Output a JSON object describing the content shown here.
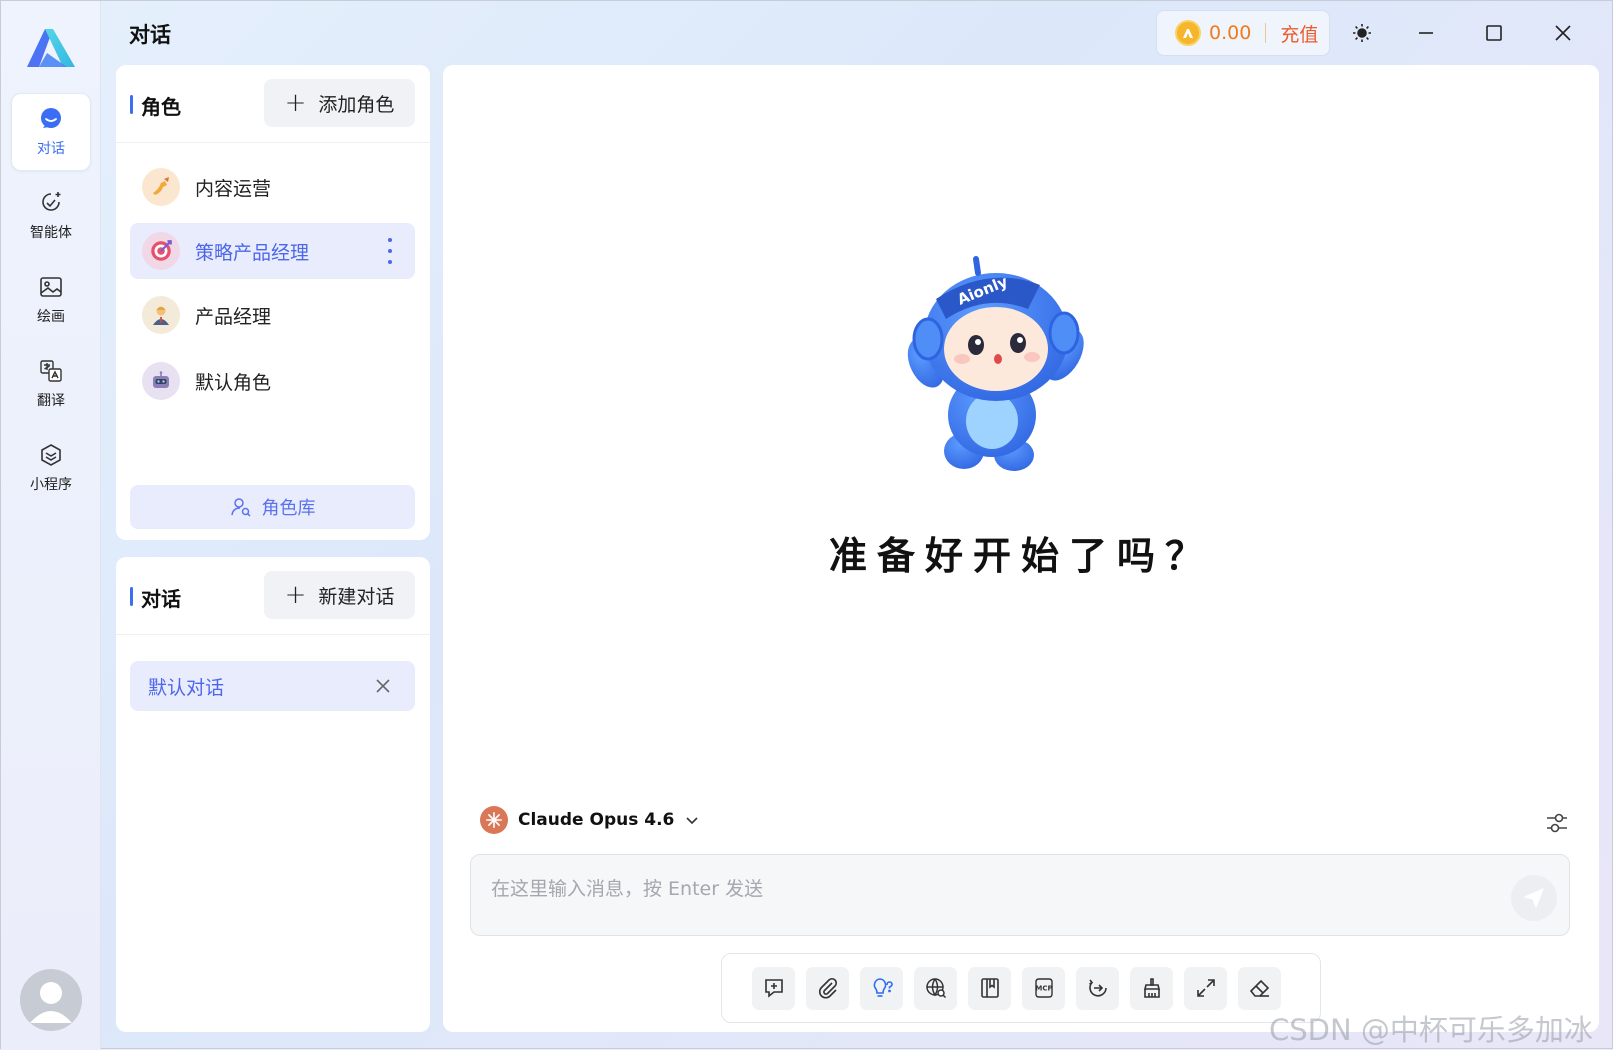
{
  "nav": {
    "items": [
      {
        "label": "对话",
        "icon": "chat-bubble-icon",
        "active": true
      },
      {
        "label": "智能体",
        "icon": "agent-icon"
      },
      {
        "label": "绘画",
        "icon": "image-icon"
      },
      {
        "label": "翻译",
        "icon": "translate-icon"
      },
      {
        "label": "小程序",
        "icon": "miniapp-icon"
      }
    ]
  },
  "header": {
    "title": "对话",
    "balance": "0.00",
    "recharge": "充值"
  },
  "roles": {
    "title": "角色",
    "add_label": "添加角色",
    "items": [
      {
        "label": "内容运营",
        "icon": "writing-hand-icon"
      },
      {
        "label": "策略产品经理",
        "icon": "target-icon",
        "selected": true
      },
      {
        "label": "产品经理",
        "icon": "person-icon"
      },
      {
        "label": "默认角色",
        "icon": "robot-icon"
      }
    ],
    "library_label": "角色库"
  },
  "chats": {
    "title": "对话",
    "new_label": "新建对话",
    "items": [
      {
        "label": "默认对话",
        "selected": true
      }
    ]
  },
  "main": {
    "mascot_text": "Aionly",
    "headline": "准备好开始了吗？",
    "model": "Claude Opus 4.6",
    "input_placeholder": "在这里输入消息，按 Enter 发送"
  },
  "watermark": "CSDN @中杯可乐多加冰",
  "colors": {
    "accent": "#3b6ef2",
    "selected_bg": "#e9ecfd",
    "recharge": "#ea5b2d",
    "balance": "#f07b1b"
  }
}
